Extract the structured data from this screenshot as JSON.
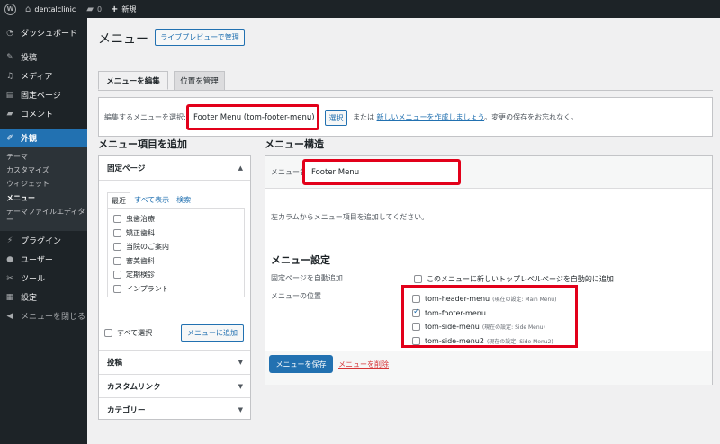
{
  "adminbar": {
    "wp_logo": "W",
    "site_name": "dentalclinic",
    "comments_count": "0",
    "new_label": "新規"
  },
  "sidebar": {
    "dashboard": "ダッシュボード",
    "posts": "投稿",
    "media": "メディア",
    "pages": "固定ページ",
    "comments": "コメント",
    "appearance": "外観",
    "sub": {
      "themes": "テーマ",
      "customize": "カスタマイズ",
      "widgets": "ウィジェット",
      "menus": "メニュー",
      "theme_editor": "テーマファイルエディター"
    },
    "plugins": "プラグイン",
    "users": "ユーザー",
    "tools": "ツール",
    "settings": "設定",
    "collapse": "メニューを閉じる"
  },
  "header": {
    "title": "メニュー",
    "live_preview": "ライブプレビューで管理"
  },
  "tabs": {
    "edit": "メニューを編集",
    "locations": "位置を管理"
  },
  "manage": {
    "label": "編集するメニューを選択:",
    "selected": "Footer Menu (tom-footer-menu)",
    "select_button": "選択",
    "or_text": "または",
    "create_link": "新しいメニューを作成しましょう",
    "note": "。変更の保存をお忘れなく。"
  },
  "add_items": {
    "title": "メニュー項目を追加",
    "pages_section": "固定ページ",
    "subtabs": [
      "最近",
      "すべて表示",
      "検索"
    ],
    "pages": [
      "虫歯治療",
      "矯正歯科",
      "当院のご案内",
      "審美歯科",
      "定期検診",
      "インプラント"
    ],
    "select_all": "すべて選択",
    "add_button": "メニューに追加",
    "posts": "投稿",
    "custom_links": "カスタムリンク",
    "categories": "カテゴリー"
  },
  "structure": {
    "title": "メニュー構造",
    "name_label": "メニュー名",
    "name_value": "Footer Menu",
    "hint": "左カラムからメニュー項目を追加してください。",
    "settings_title": "メニュー設定",
    "auto_add_label": "固定ページを自動追加",
    "auto_add_text": "このメニューに新しいトップレベルページを自動的に追加",
    "locations_label": "メニューの位置",
    "locations": [
      {
        "name": "tom-header-menu",
        "note": "(現在の設定: Main Menu)",
        "checked": false
      },
      {
        "name": "tom-footer-menu",
        "note": "",
        "checked": true
      },
      {
        "name": "tom-side-menu",
        "note": "(現在の設定: Side Menu)",
        "checked": false
      },
      {
        "name": "tom-side-menu2",
        "note": "(現在の設定: Side Menu2)",
        "checked": false
      }
    ],
    "save_button": "メニューを保存",
    "delete_link": "メニューを削除"
  },
  "colors": {
    "admin_dark": "#1d2327",
    "accent_blue": "#2271b1",
    "highlight_red": "#e2001a",
    "delete_red": "#d63638"
  }
}
